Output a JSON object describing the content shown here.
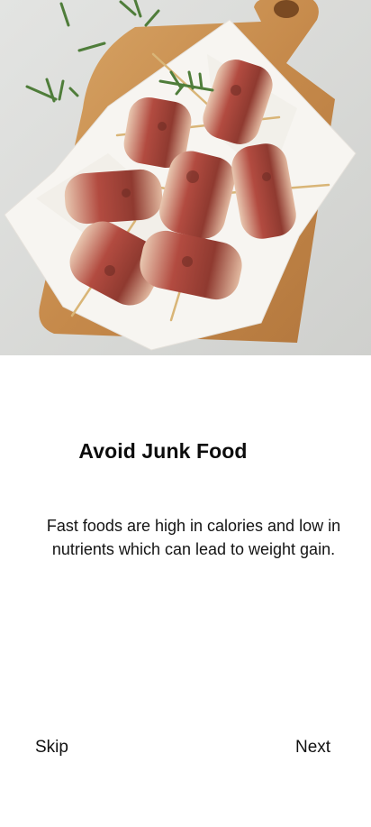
{
  "hero": {
    "image_icon": "bacon-wrapped-skewers-photo"
  },
  "onboarding": {
    "title": "Avoid Junk Food",
    "description": "Fast foods are high in calories and low in nutrients which can lead to weight gain."
  },
  "actions": {
    "skip_label": "Skip",
    "next_label": "Next"
  },
  "colors": {
    "background": "#ffffff",
    "text": "#111111",
    "photo_backdrop": "#d9dad8",
    "board": "#c98f4f",
    "paper": "#f6f4f0",
    "bacon": "#a8423a"
  }
}
